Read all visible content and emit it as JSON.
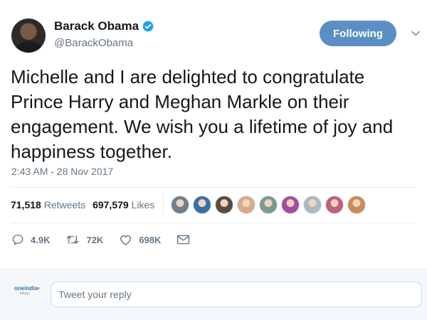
{
  "user": {
    "name": "Barack Obama",
    "handle": "@BarackObama",
    "verified": true
  },
  "follow_button": {
    "label": "Following",
    "color": "#5b8ec4"
  },
  "tweet": {
    "text": "Michelle and I are delighted to congratulate Prince Harry and Meghan Markle on their engagement. We wish you a lifetime of joy and happiness together.",
    "timestamp": "2:43 AM - 28 Nov 2017"
  },
  "stats": {
    "retweets_count": "71,518",
    "retweets_label": "Retweets",
    "likes_count": "697,579",
    "likes_label": "Likes"
  },
  "likers": [
    {
      "icon": "liker-avatar",
      "color": "#6e7f8e"
    },
    {
      "icon": "liker-avatar",
      "color": "#3a6ea5"
    },
    {
      "icon": "liker-avatar",
      "color": "#5a4a3f"
    },
    {
      "icon": "liker-avatar",
      "color": "#d8a98c"
    },
    {
      "icon": "liker-avatar",
      "color": "#7c9a8a"
    },
    {
      "icon": "liker-avatar",
      "color": "#a44ea0"
    },
    {
      "icon": "liker-avatar",
      "color": "#aab8c2"
    },
    {
      "icon": "liker-avatar",
      "color": "#c0607a"
    },
    {
      "icon": "liker-avatar",
      "color": "#c98b5a"
    }
  ],
  "actions": {
    "reply_count": "4.9K",
    "retweet_count": "72K",
    "like_count": "698K"
  },
  "reply": {
    "placeholder": "Tweet your reply",
    "logo_text": "oneindia",
    "logo_sub": "telugu"
  },
  "colors": {
    "text_primary": "#14171a",
    "text_secondary": "#657786",
    "verified_blue": "#1da1f2"
  }
}
